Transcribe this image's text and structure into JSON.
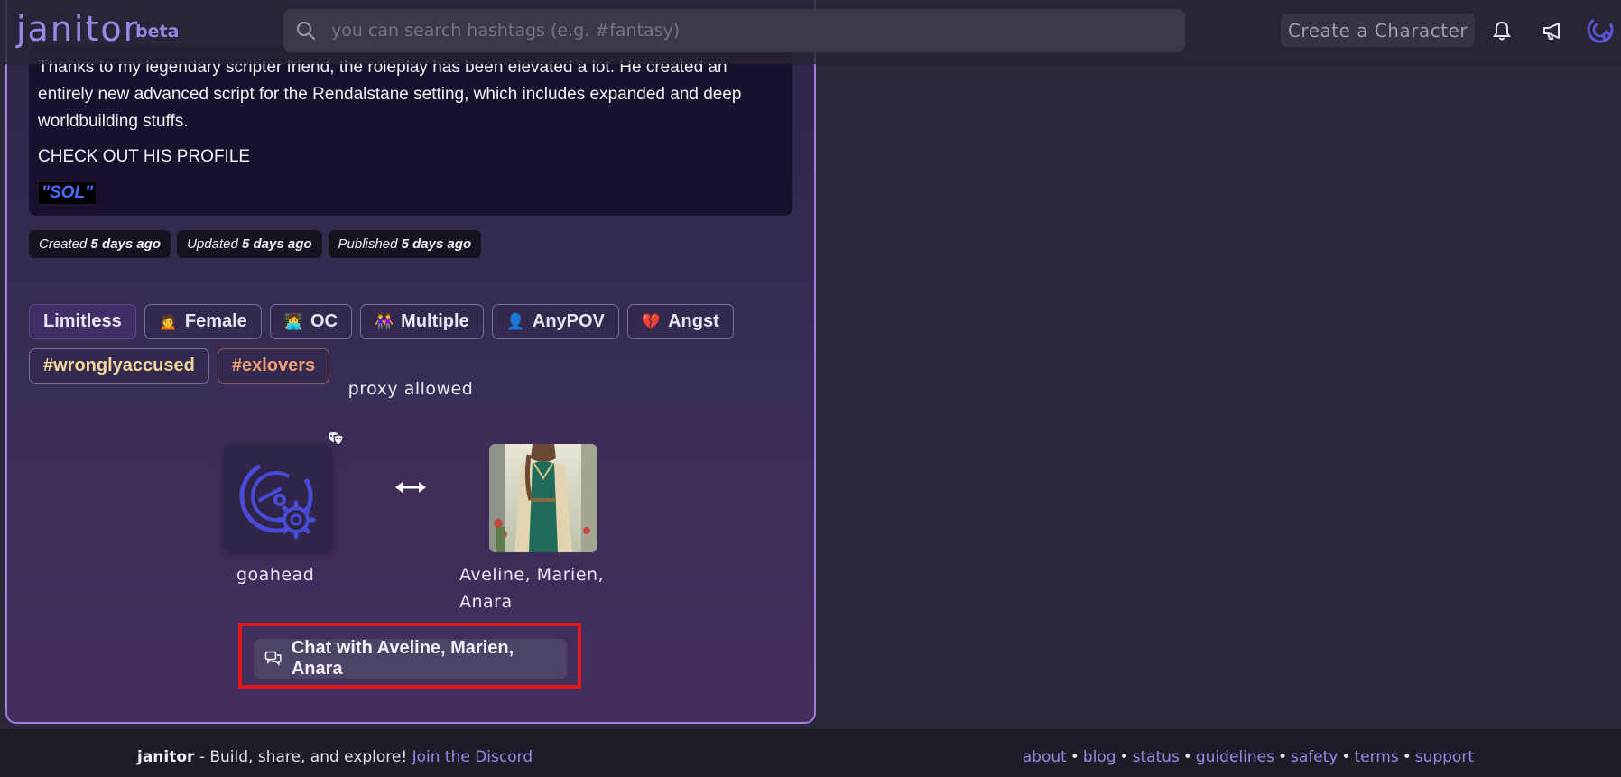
{
  "header": {
    "logo": "janitor",
    "logo_badge": "beta",
    "search_placeholder": "you can search hashtags (e.g. #fantasy)",
    "create_label": "Create a Character"
  },
  "description": {
    "paragraph1": "Thanks to my legendary scripter friend, the roleplay has been elevated a lot. He created an entirely new advanced script for the Rendalstane setting, which includes expanded and deep worldbuilding stuffs.",
    "paragraph2": "CHECK OUT HIS PROFILE",
    "highlight": "\"SOL\""
  },
  "dates": [
    {
      "label": "Created",
      "value": "5 days ago"
    },
    {
      "label": "Updated",
      "value": "5 days ago"
    },
    {
      "label": "Published",
      "value": "5 days ago"
    }
  ],
  "tags": [
    {
      "emoji": "",
      "label": "Limitless"
    },
    {
      "emoji": "🙍",
      "label": "Female"
    },
    {
      "emoji": "👩‍💻",
      "label": "OC"
    },
    {
      "emoji": "👭",
      "label": "Multiple"
    },
    {
      "emoji": "👤",
      "label": "AnyPOV"
    },
    {
      "emoji": "💔",
      "label": "Angst"
    },
    {
      "emoji": "",
      "label": "#wronglyaccused"
    },
    {
      "emoji": "",
      "label": "#exlovers"
    }
  ],
  "proxy_text": "proxy allowed",
  "persona": {
    "name": "goahead"
  },
  "character": {
    "name": "Aveline, Marien, Anara"
  },
  "chat_button": "Chat with Aveline, Marien, Anara",
  "footer": {
    "brand": "janitor",
    "tagline": " - Build, share, and explore! ",
    "discord": "Join the Discord",
    "links": [
      "about",
      "blog",
      "status",
      "guidelines",
      "safety",
      "terms",
      "support"
    ]
  },
  "colors": {
    "accent": "#9a88e8",
    "card_border": "#9f7fe0",
    "highlight_frame": "#e01818"
  }
}
